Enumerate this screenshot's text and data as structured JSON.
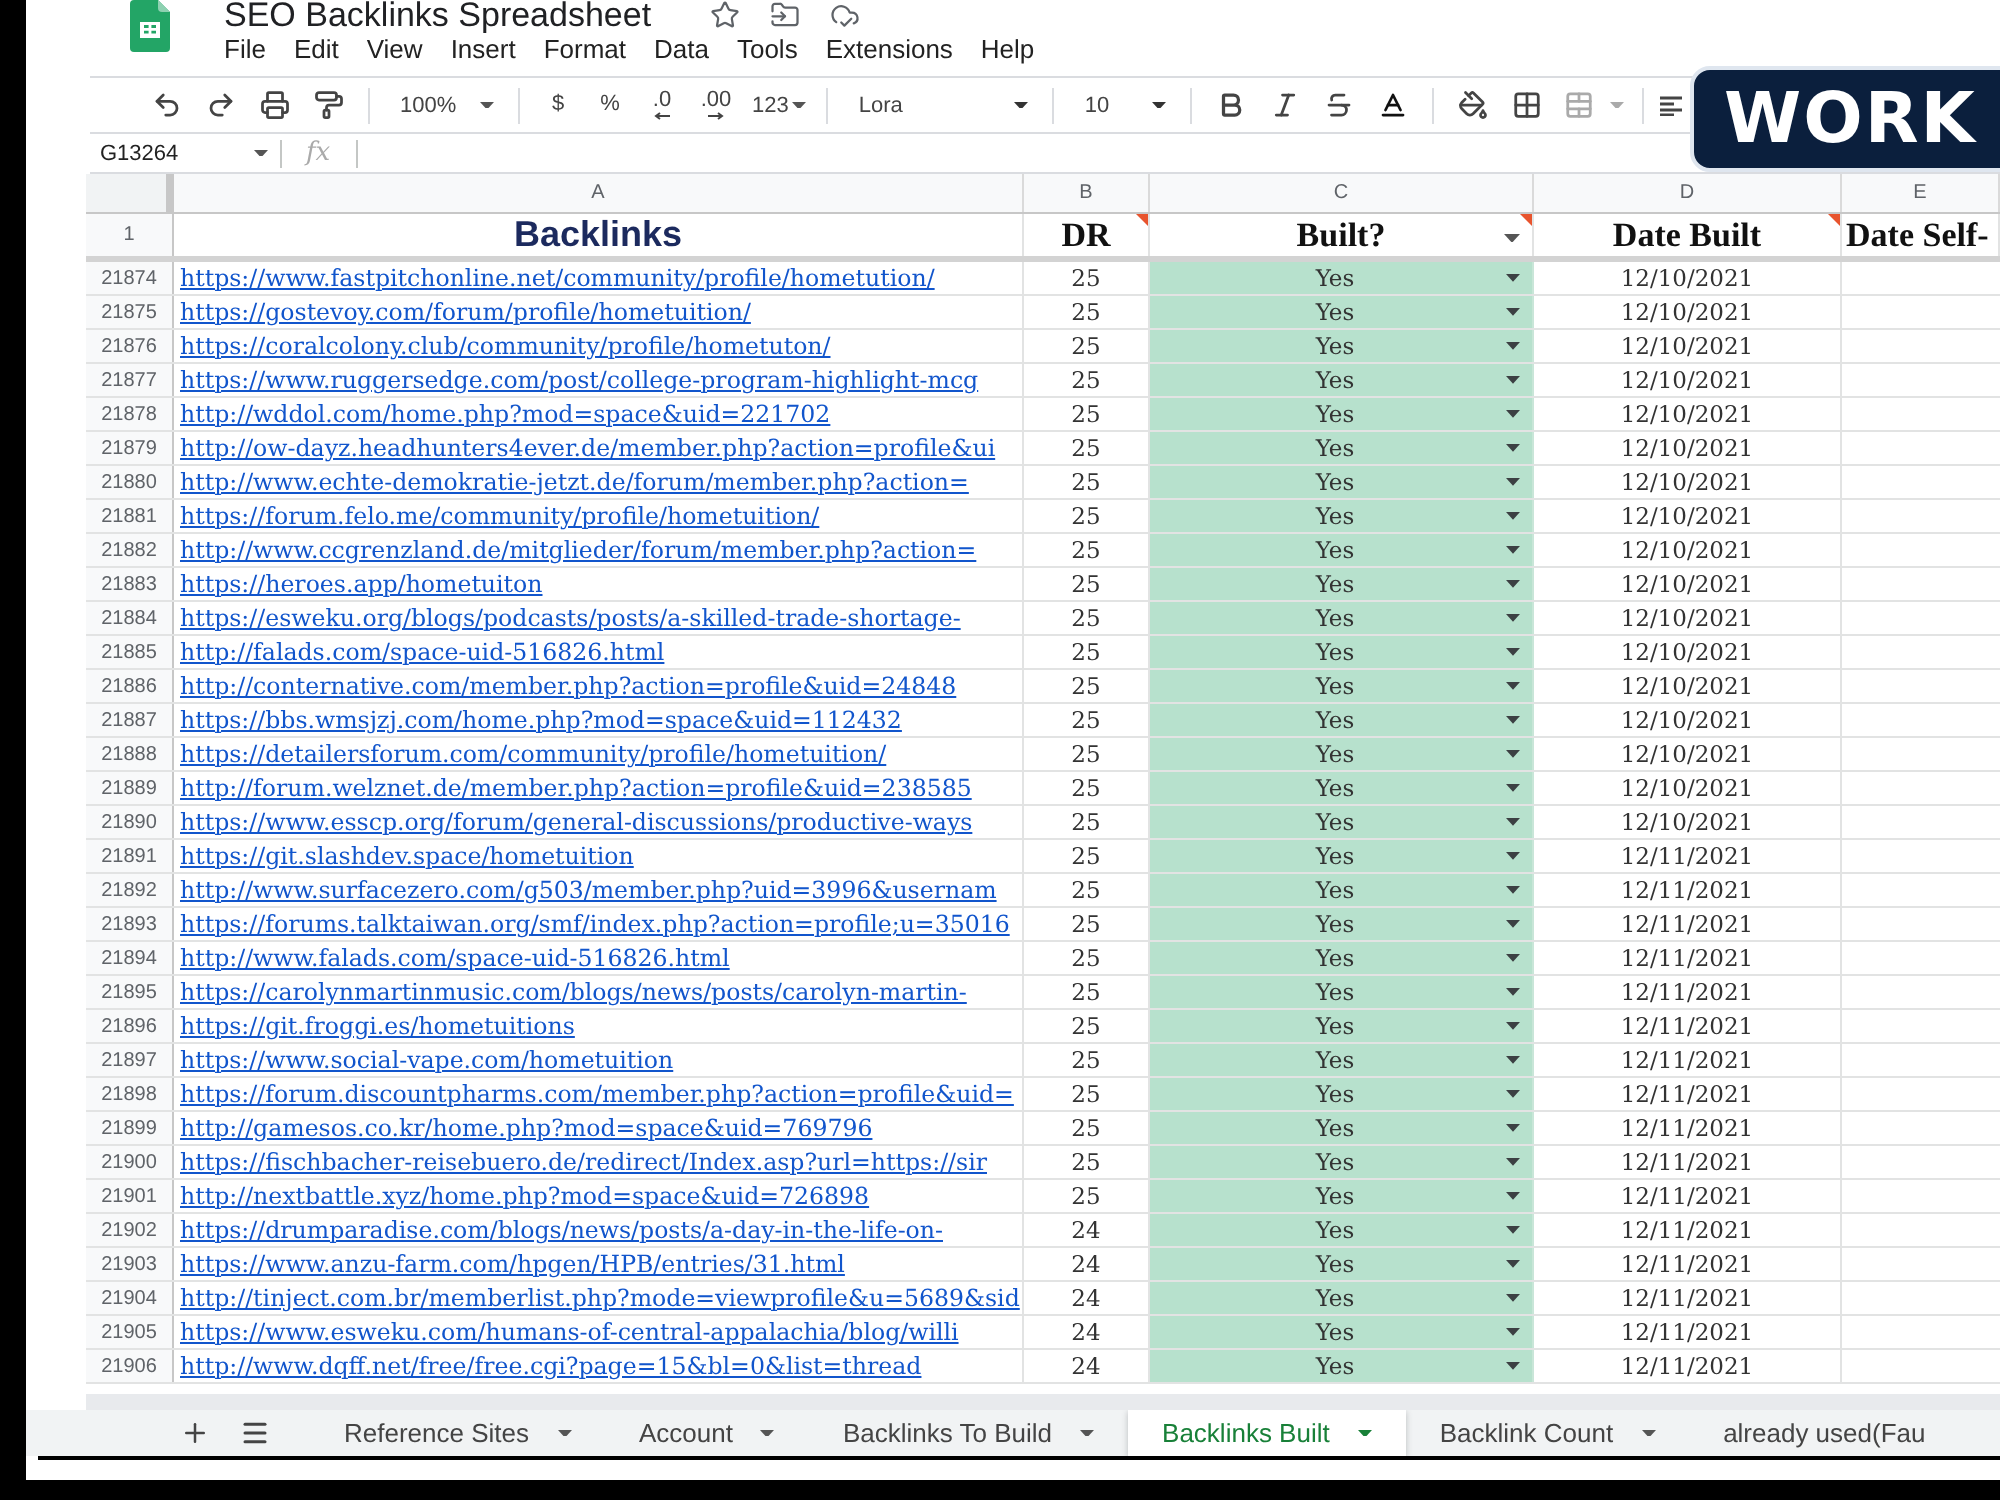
{
  "document": {
    "title": "SEO Backlinks Spreadsheet"
  },
  "menu": [
    "File",
    "Edit",
    "View",
    "Insert",
    "Format",
    "Data",
    "Tools",
    "Extensions",
    "Help"
  ],
  "toolbar": {
    "zoom": "100%",
    "currency": "$",
    "percent": "%",
    "fewer_decimals": ".0",
    "more_decimals": ".00",
    "number_format": "123",
    "font": "Lora",
    "font_size": "10"
  },
  "formula_bar": {
    "name_box": "G13264",
    "fx": "fx"
  },
  "overlay_banner": {
    "text": "WORK"
  },
  "sheet": {
    "columns": [
      {
        "letter": "A",
        "header": "Backlinks",
        "kind": "link",
        "note": false,
        "filter": false
      },
      {
        "letter": "B",
        "header": "DR",
        "kind": "number",
        "note": true,
        "filter": false
      },
      {
        "letter": "C",
        "header": "Built?",
        "kind": "dropdown",
        "note": true,
        "filter": true
      },
      {
        "letter": "D",
        "header": "Date Built",
        "kind": "date",
        "note": true,
        "filter": false
      },
      {
        "letter": "E",
        "header": "Date Self-",
        "kind": "date",
        "note": false,
        "filter": false
      }
    ],
    "header_row": "1",
    "rows": [
      {
        "number": "21874",
        "url": "https://www.fastpitchonline.net/community/profile/hometution/",
        "dr": "25",
        "built": "Yes",
        "date": "12/10/2021"
      },
      {
        "number": "21875",
        "url": "https://gostevoy.com/forum/profile/hometuition/",
        "dr": "25",
        "built": "Yes",
        "date": "12/10/2021"
      },
      {
        "number": "21876",
        "url": "https://coralcolony.club/community/profile/hometuton/",
        "dr": "25",
        "built": "Yes",
        "date": "12/10/2021"
      },
      {
        "number": "21877",
        "url": "https://www.ruggersedge.com/post/college-program-highlight-mcg",
        "dr": "25",
        "built": "Yes",
        "date": "12/10/2021"
      },
      {
        "number": "21878",
        "url": "http://wddol.com/home.php?mod=space&uid=221702",
        "dr": "25",
        "built": "Yes",
        "date": "12/10/2021"
      },
      {
        "number": "21879",
        "url": "http://ow-dayz.headhunters4ever.de/member.php?action=profile&ui",
        "dr": "25",
        "built": "Yes",
        "date": "12/10/2021"
      },
      {
        "number": "21880",
        "url": "http://www.echte-demokratie-jetzt.de/forum/member.php?action=",
        "dr": "25",
        "built": "Yes",
        "date": "12/10/2021"
      },
      {
        "number": "21881",
        "url": "https://forum.felo.me/community/profile/hometuition/",
        "dr": "25",
        "built": "Yes",
        "date": "12/10/2021"
      },
      {
        "number": "21882",
        "url": "http://www.ccgrenzland.de/mitglieder/forum/member.php?action=",
        "dr": "25",
        "built": "Yes",
        "date": "12/10/2021"
      },
      {
        "number": "21883",
        "url": "https://heroes.app/hometuiton",
        "dr": "25",
        "built": "Yes",
        "date": "12/10/2021"
      },
      {
        "number": "21884",
        "url": "https://esweku.org/blogs/podcasts/posts/a-skilled-trade-shortage-",
        "dr": "25",
        "built": "Yes",
        "date": "12/10/2021"
      },
      {
        "number": "21885",
        "url": "http://falads.com/space-uid-516826.html",
        "dr": "25",
        "built": "Yes",
        "date": "12/10/2021"
      },
      {
        "number": "21886",
        "url": "http://conternative.com/member.php?action=profile&uid=24848",
        "dr": "25",
        "built": "Yes",
        "date": "12/10/2021"
      },
      {
        "number": "21887",
        "url": "https://bbs.wmsjzj.com/home.php?mod=space&uid=112432",
        "dr": "25",
        "built": "Yes",
        "date": "12/10/2021"
      },
      {
        "number": "21888",
        "url": "https://detailersforum.com/community/profile/hometuition/",
        "dr": "25",
        "built": "Yes",
        "date": "12/10/2021"
      },
      {
        "number": "21889",
        "url": "http://forum.welznet.de/member.php?action=profile&uid=238585",
        "dr": "25",
        "built": "Yes",
        "date": "12/10/2021"
      },
      {
        "number": "21890",
        "url": "https://www.esscp.org/forum/general-discussions/productive-ways",
        "dr": "25",
        "built": "Yes",
        "date": "12/10/2021"
      },
      {
        "number": "21891",
        "url": "https://git.slashdev.space/hometuition",
        "dr": "25",
        "built": "Yes",
        "date": "12/11/2021"
      },
      {
        "number": "21892",
        "url": "http://www.surfacezero.com/g503/member.php?uid=3996&usernam",
        "dr": "25",
        "built": "Yes",
        "date": "12/11/2021"
      },
      {
        "number": "21893",
        "url": "https://forums.talktaiwan.org/smf/index.php?action=profile;u=35016",
        "dr": "25",
        "built": "Yes",
        "date": "12/11/2021"
      },
      {
        "number": "21894",
        "url": "http://www.falads.com/space-uid-516826.html",
        "dr": "25",
        "built": "Yes",
        "date": "12/11/2021"
      },
      {
        "number": "21895",
        "url": "https://carolynmartinmusic.com/blogs/news/posts/carolyn-martin-",
        "dr": "25",
        "built": "Yes",
        "date": "12/11/2021"
      },
      {
        "number": "21896",
        "url": "https://git.froggi.es/hometuitions",
        "dr": "25",
        "built": "Yes",
        "date": "12/11/2021"
      },
      {
        "number": "21897",
        "url": "https://www.social-vape.com/hometuition",
        "dr": "25",
        "built": "Yes",
        "date": "12/11/2021"
      },
      {
        "number": "21898",
        "url": "https://forum.discountpharms.com/member.php?action=profile&uid=",
        "dr": "25",
        "built": "Yes",
        "date": "12/11/2021"
      },
      {
        "number": "21899",
        "url": "http://gamesos.co.kr/home.php?mod=space&uid=769796",
        "dr": "25",
        "built": "Yes",
        "date": "12/11/2021"
      },
      {
        "number": "21900",
        "url": "https://fischbacher-reisebuero.de/redirect/Index.asp?url=https://sir",
        "dr": "25",
        "built": "Yes",
        "date": "12/11/2021"
      },
      {
        "number": "21901",
        "url": "http://nextbattle.xyz/home.php?mod=space&uid=726898",
        "dr": "25",
        "built": "Yes",
        "date": "12/11/2021"
      },
      {
        "number": "21902",
        "url": "https://drumparadise.com/blogs/news/posts/a-day-in-the-life-on-",
        "dr": "24",
        "built": "Yes",
        "date": "12/11/2021"
      },
      {
        "number": "21903",
        "url": "https://www.anzu-farm.com/hpgen/HPB/entries/31.html",
        "dr": "24",
        "built": "Yes",
        "date": "12/11/2021"
      },
      {
        "number": "21904",
        "url": "http://tinject.com.br/memberlist.php?mode=viewprofile&u=5689&sid",
        "dr": "24",
        "built": "Yes",
        "date": "12/11/2021"
      },
      {
        "number": "21905",
        "url": "https://www.esweku.com/humans-of-central-appalachia/blog/willi",
        "dr": "24",
        "built": "Yes",
        "date": "12/11/2021"
      },
      {
        "number": "21906",
        "url": "http://www.dqff.net/free/free.cgi?page=15&bl=0&list=thread",
        "dr": "24",
        "built": "Yes",
        "date": "12/11/2021"
      }
    ]
  },
  "sheet_tabs": [
    {
      "label": "Reference Sites",
      "selected": false,
      "dropdown": true
    },
    {
      "label": "Account",
      "selected": false,
      "dropdown": true
    },
    {
      "label": "Backlinks To Build",
      "selected": false,
      "dropdown": true
    },
    {
      "label": "Backlinks Built",
      "selected": true,
      "dropdown": true
    },
    {
      "label": "Backlink Count",
      "selected": false,
      "dropdown": true
    },
    {
      "label": "already used(Fau",
      "selected": false,
      "dropdown": false
    }
  ]
}
